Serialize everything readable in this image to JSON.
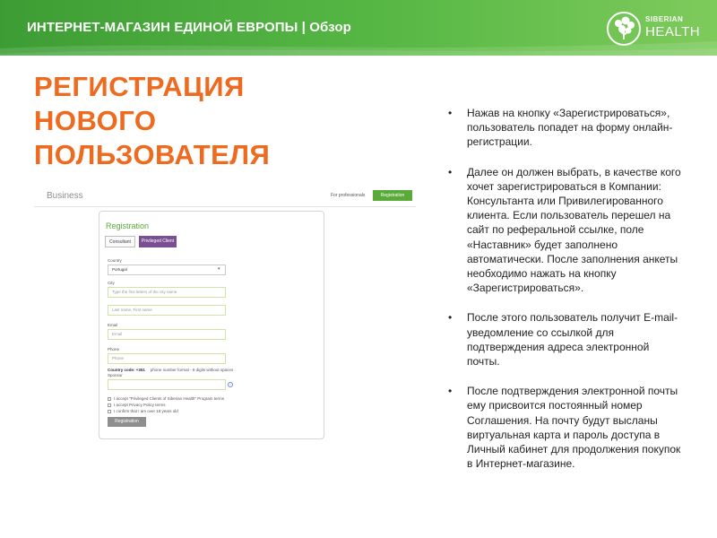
{
  "header": {
    "title": "ИНТЕРНЕТ-МАГАЗИН ЕДИНОЙ ЕВРОПЫ | Обзор",
    "logo_line1": "SIBERIAN",
    "logo_line2": "HEALTH"
  },
  "slide_title": {
    "line1": "РЕГИСТРАЦИЯ",
    "line2": "НОВОГО",
    "line3": "ПОЛЬЗОВАТЕЛЯ"
  },
  "screenshot": {
    "brand": "Business",
    "for_professionals": "For professionals",
    "top_register_button": "Registration",
    "form": {
      "title": "Registration",
      "tab_consultant": "Consultant",
      "tab_privileged": "Privileged Client",
      "country_label": "Country",
      "country_value": "Portugal",
      "city_label": "City",
      "city_placeholder": "Type the first letters of the city name",
      "name_placeholder": "Last name, First name",
      "email_label": "Email",
      "email_placeholder": "Email",
      "phone_label": "Phone",
      "phone_placeholder": "Phone",
      "country_code_label": "Country code: +351",
      "phone_format": "phone number format - 9 digits without spaces",
      "sponsor_label": "Sponsor",
      "checkbox1": "I accept \"Privileged Clients of Siberian Health\" Program terms",
      "checkbox2": "I accept Privacy Policy terms",
      "checkbox3": "I confirm that I am over 18 years old",
      "submit": "Registration"
    }
  },
  "bullets": [
    "Нажав на кнопку «Зарегистрироваться», пользователь попадет на форму онлайн-регистрации.",
    "Далее он должен выбрать, в качестве кого хочет зарегистрироваться в Компании: Консультанта или Привилегированного клиента. Если пользователь перешел на сайт по реферальной ссылке, поле «Наставник» будет заполнено автоматически. После заполнения анкеты необходимо нажать на кнопку «Зарегистрироваться».",
    "После этого пользователь получит E-mail-уведомление со ссылкой для подтверждения адреса электронной почты.",
    "После подтверждения электронной почты ему присвоится постоянный номер Соглашения. На почту будут высланы виртуальная карта и пароль доступа в Личный кабинет для продолжения покупок в Интернет-магазине."
  ],
  "colors": {
    "header_green": "#4caf3e",
    "title_orange": "#ed6a1f",
    "form_green": "#5aaa3a",
    "privileged_purple": "#7a4e93"
  }
}
